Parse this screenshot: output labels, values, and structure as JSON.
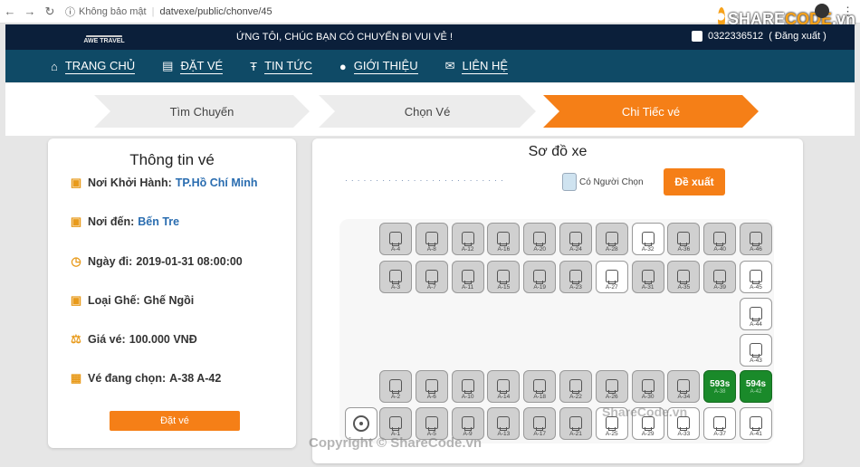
{
  "browser": {
    "security": "Không bảo mật",
    "url": "datvexe/public/chonve/45"
  },
  "brand": {
    "part1": "SHARE",
    "part2": "CODE",
    "part3": ".vn"
  },
  "topbar": {
    "logo": "AWE TRAVEL",
    "welcome": "ỨNG TÔI, CHÚC BẠN CÓ CHUYẾN ĐI VUI VẺ !",
    "phone": "0322336512",
    "logout": "( Đăng xuất )"
  },
  "nav": [
    {
      "icon": "home-icon",
      "label": "TRANG CHỦ"
    },
    {
      "icon": "list-icon",
      "label": "ĐẶT VÉ"
    },
    {
      "icon": "text-icon",
      "label": "TIN TỨC"
    },
    {
      "icon": "info-icon",
      "label": "GIỚI THIỆU"
    },
    {
      "icon": "mail-icon",
      "label": "LIÊN HỆ"
    }
  ],
  "steps": {
    "s1": "Tìm Chuyến",
    "s2": "Chọn Vé",
    "s3": "Chi Tiếc vé"
  },
  "info": {
    "title": "Thông tin vé",
    "origin_label": "Nơi Khởi Hành:",
    "origin": "TP.Hồ Chí Minh",
    "dest_label": "Nơi đến:",
    "dest": "Bến Tre",
    "date_label": "Ngày đi:",
    "date": "2019-01-31 08:00:00",
    "seat_type_label": "Loại Ghế:",
    "seat_type": "Ghế Ngồi",
    "price_label": "Giá vé:",
    "price": "100.000 VNĐ",
    "selected_label": "Vé đang chọn:",
    "selected": "A-38 A-42",
    "book_button": "Đặt vé"
  },
  "seatmap": {
    "title": "Sơ đồ xe",
    "legend_taken": "Có Người Chọn",
    "suggest_button": "Đề xuất",
    "row1": [
      "A-4",
      "A-8",
      "A-12",
      "A-16",
      "A-20",
      "A-24",
      "A-28",
      "A-32",
      "A-36",
      "A-40",
      "A-46"
    ],
    "row1_avail": [
      false,
      false,
      false,
      false,
      false,
      false,
      false,
      true,
      false,
      false,
      false
    ],
    "row2": [
      "A-3",
      "A-7",
      "A-11",
      "A-15",
      "A-19",
      "A-23",
      "A-27",
      "A-31",
      "A-35",
      "A-39",
      "A-45"
    ],
    "row2_avail": [
      false,
      false,
      false,
      false,
      false,
      false,
      true,
      false,
      false,
      false,
      true
    ],
    "mid": [
      "A-44",
      "A-43"
    ],
    "row4": [
      "A-2",
      "A-6",
      "A-10",
      "A-14",
      "A-18",
      "A-22",
      "A-26",
      "A-30",
      "A-34",
      "A-38",
      "A-42"
    ],
    "row4_avail": [
      false,
      false,
      false,
      false,
      false,
      false,
      false,
      false,
      false,
      false,
      false
    ],
    "selected_names": {
      "A-38": "593s",
      "A-42": "594s"
    },
    "row5": [
      "A-1",
      "A-5",
      "A-9",
      "A-13",
      "A-17",
      "A-21",
      "A-25",
      "A-29",
      "A-33",
      "A-37",
      "A-41"
    ],
    "row5_avail": [
      false,
      false,
      false,
      false,
      false,
      false,
      true,
      true,
      true,
      true,
      true
    ]
  },
  "watermarks": {
    "w1": "Copyright © ShareCode.vn",
    "w2": "ShareCode.vn"
  }
}
